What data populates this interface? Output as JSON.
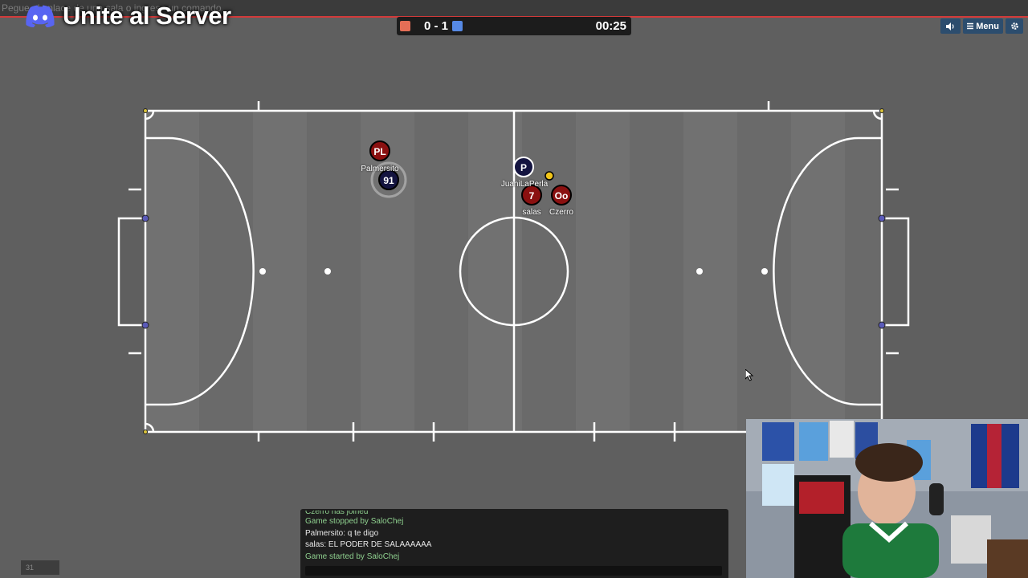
{
  "topbar": {
    "placeholder": "Pegue el enlace de una sala o ingrese un comando"
  },
  "overlay": {
    "title": "Unite al Server"
  },
  "scoreboard": {
    "red_color": "#e56e56",
    "blue_color": "#5689e5",
    "score": "0 - 1",
    "timer": "00:25"
  },
  "controls": {
    "sound_icon": "speaker-icon",
    "menu_label": "Menu",
    "settings_icon": "gear-icon"
  },
  "players": [
    {
      "id": "palmersito",
      "avatar": "PL",
      "name": "Palmersito",
      "team": "red"
    },
    {
      "id": "91",
      "avatar": "91",
      "name": "",
      "team": "blue"
    },
    {
      "id": "juani",
      "avatar": "P",
      "name": "JuaniLaPerla",
      "team": "blue"
    },
    {
      "id": "salas",
      "avatar": "7",
      "name": "salas",
      "team": "red"
    },
    {
      "id": "czerro",
      "avatar": "Oo",
      "name": "Czerro",
      "team": "red"
    }
  ],
  "chat": {
    "lines": [
      {
        "text": "Czerro has joined",
        "kind": "sys"
      },
      {
        "text": "Game stopped by SaloChej",
        "kind": "sys"
      },
      {
        "text": "Palmersito: q te digo",
        "kind": "msg"
      },
      {
        "text": "salas: EL PODER DE SALAAAAAA",
        "kind": "msg"
      },
      {
        "text": "Game started by SaloChej",
        "kind": "sys"
      }
    ]
  },
  "corner": {
    "text": "31"
  }
}
